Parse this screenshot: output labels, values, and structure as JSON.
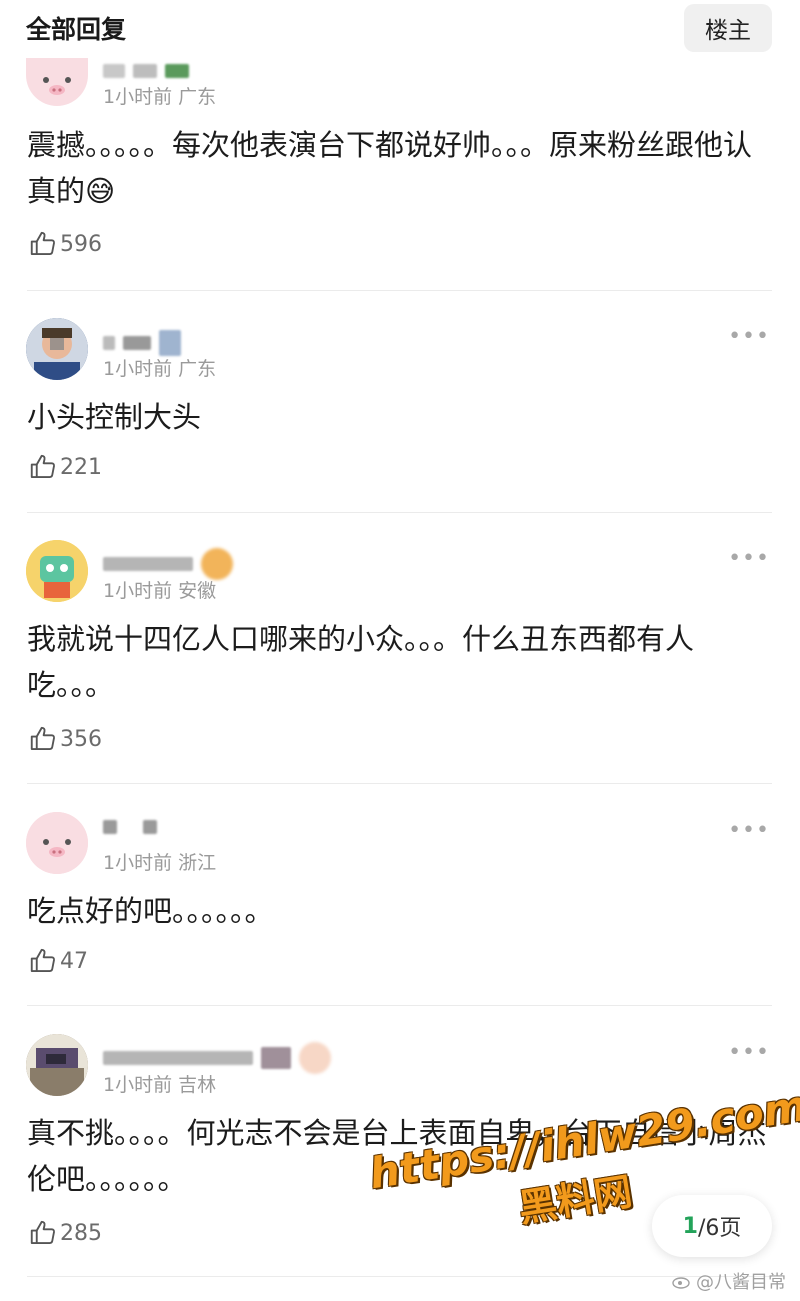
{
  "header": {
    "title": "全部回复",
    "op_button": "楼主"
  },
  "comments": [
    {
      "time": "1小时前",
      "region": "广东",
      "text": "震撼。。。。。每次他表演台下都说好帅。。。原来粉丝跟他认真的😅",
      "likes": "596"
    },
    {
      "time": "1小时前",
      "region": "广东",
      "text": "小头控制大头",
      "likes": "221"
    },
    {
      "time": "1小时前",
      "region": "安徽",
      "text": "我就说十四亿人口哪来的小众。。。什么丑东西都有人吃。。。",
      "likes": "356"
    },
    {
      "time": "1小时前",
      "region": "浙江",
      "text": "吃点好的吧。。。。。。",
      "likes": "47"
    },
    {
      "time": "1小时前",
      "region": "吉林",
      "text": "真不挑。。。。何光志不会是台上表面自卑，台下自信小周杰伦吧。。。。。。",
      "likes": "285"
    }
  ],
  "watermark": {
    "url": "https://ihlw29.com",
    "name": "黑料网"
  },
  "pager": {
    "current": "1",
    "rest": "/6页"
  },
  "source": "@八酱目常",
  "icons": {
    "like": "thumbs-up-icon",
    "more": "more-dots-icon"
  },
  "colors": {
    "accent": "#23a35a",
    "watermark": "#f29a1c",
    "meta": "#9a9a9a"
  }
}
